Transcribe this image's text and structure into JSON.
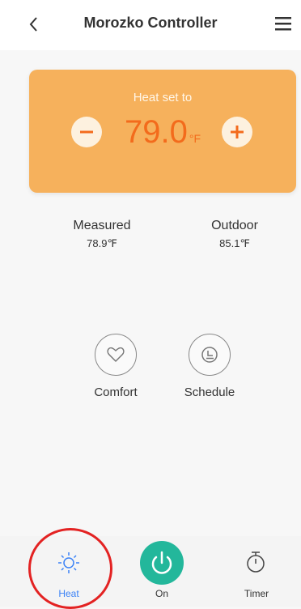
{
  "header": {
    "title": "Morozko Controller",
    "back_icon": "chevron-left-icon",
    "menu_icon": "hamburger-menu-icon"
  },
  "setpoint": {
    "label": "Heat set to",
    "value": "79.0",
    "unit": "°F",
    "decrease_icon": "minus-icon",
    "increase_icon": "plus-icon",
    "card_color": "#f6b15c",
    "value_color": "#f36b1c"
  },
  "readings": {
    "measured": {
      "label": "Measured",
      "value": "78.9℉"
    },
    "outdoor": {
      "label": "Outdoor",
      "value": "85.1℉"
    }
  },
  "actions": [
    {
      "label": "Comfort",
      "icon": "heart-icon"
    },
    {
      "label": "Schedule",
      "icon": "schedule-icon"
    }
  ],
  "tabbar": {
    "tabs": [
      {
        "label": "Heat",
        "icon": "sun-icon",
        "active": true,
        "color": "#3b82f6"
      },
      {
        "label": "On",
        "icon": "power-icon",
        "color": "#23b79b"
      },
      {
        "label": "Timer",
        "icon": "stopwatch-icon"
      }
    ]
  },
  "annotation_color": "#e32222"
}
